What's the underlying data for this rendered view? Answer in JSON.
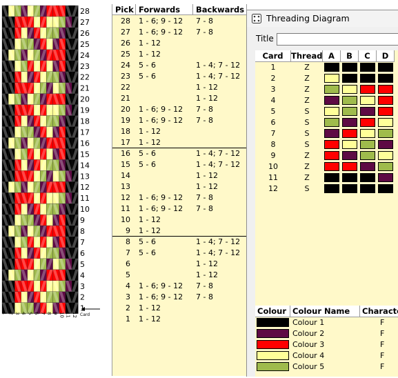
{
  "pick_table": {
    "headers": [
      "Pick",
      "Forwards",
      "Backwards"
    ],
    "rows": [
      {
        "pick": "28",
        "forwards": "1 - 6; 9 - 12",
        "backwards": "7 - 8"
      },
      {
        "pick": "27",
        "forwards": "1 - 6; 9 - 12",
        "backwards": "7 - 8"
      },
      {
        "pick": "26",
        "forwards": "1 - 12",
        "backwards": ""
      },
      {
        "pick": "25",
        "forwards": "1 - 12",
        "backwards": ""
      },
      {
        "pick": "24",
        "forwards": "5 - 6",
        "backwards": "1 - 4; 7 - 12"
      },
      {
        "pick": "23",
        "forwards": "5 - 6",
        "backwards": "1 - 4; 7 - 12"
      },
      {
        "pick": "22",
        "forwards": "",
        "backwards": "1 - 12"
      },
      {
        "pick": "21",
        "forwards": "",
        "backwards": "1 - 12"
      },
      {
        "pick": "20",
        "forwards": "1 - 6; 9 - 12",
        "backwards": "7 - 8"
      },
      {
        "pick": "19",
        "forwards": "1 - 6; 9 - 12",
        "backwards": "7 - 8"
      },
      {
        "pick": "18",
        "forwards": "1 - 12",
        "backwards": ""
      },
      {
        "pick": "17",
        "forwards": "1 - 12",
        "backwards": ""
      },
      {
        "pick": "16",
        "forwards": "5 - 6",
        "backwards": "1 - 4; 7 - 12"
      },
      {
        "pick": "15",
        "forwards": "5 - 6",
        "backwards": "1 - 4; 7 - 12"
      },
      {
        "pick": "14",
        "forwards": "",
        "backwards": "1 - 12"
      },
      {
        "pick": "13",
        "forwards": "",
        "backwards": "1 - 12"
      },
      {
        "pick": "12",
        "forwards": "1 - 6; 9 - 12",
        "backwards": "7 - 8"
      },
      {
        "pick": "11",
        "forwards": "1 - 6; 9 - 12",
        "backwards": "7 - 8"
      },
      {
        "pick": "10",
        "forwards": "1 - 12",
        "backwards": ""
      },
      {
        "pick": "9",
        "forwards": "1 - 12",
        "backwards": ""
      },
      {
        "pick": "8",
        "forwards": "5 - 6",
        "backwards": "1 - 4; 7 - 12"
      },
      {
        "pick": "7",
        "forwards": "5 - 6",
        "backwards": "1 - 4; 7 - 12"
      },
      {
        "pick": "6",
        "forwards": "",
        "backwards": "1 - 12"
      },
      {
        "pick": "5",
        "forwards": "",
        "backwards": "1 - 12"
      },
      {
        "pick": "4",
        "forwards": "1 - 6; 9 - 12",
        "backwards": "7 - 8"
      },
      {
        "pick": "3",
        "forwards": "1 - 6; 9 - 12",
        "backwards": "7 - 8"
      },
      {
        "pick": "2",
        "forwards": "1 - 12",
        "backwards": ""
      },
      {
        "pick": "1",
        "forwards": "1 - 12",
        "backwards": ""
      }
    ]
  },
  "weave": {
    "pick_labels": [
      "28",
      "27",
      "26",
      "25",
      "24",
      "23",
      "22",
      "21",
      "20",
      "19",
      "18",
      "17",
      "16",
      "15",
      "14",
      "13",
      "12",
      "11",
      "10",
      "9",
      "8",
      "7",
      "6",
      "5",
      "4",
      "3",
      "2",
      "1"
    ],
    "card_labels": [
      "1",
      "2",
      "3",
      "4",
      "5",
      "6",
      "7",
      "8",
      "9",
      "10",
      "11",
      "12"
    ],
    "card_axis_label": "Card"
  },
  "window": {
    "title": "Threading Diagram",
    "title_label": "Title",
    "title_value": "",
    "card_headers": [
      "Card",
      "Thread",
      "A",
      "B",
      "C",
      "D"
    ],
    "cards": [
      {
        "card": "1",
        "thread": "Z",
        "holes": [
          1,
          1,
          1,
          1
        ]
      },
      {
        "card": "2",
        "thread": "Z",
        "holes": [
          4,
          1,
          1,
          1
        ]
      },
      {
        "card": "3",
        "thread": "Z",
        "holes": [
          5,
          4,
          3,
          3
        ]
      },
      {
        "card": "4",
        "thread": "Z",
        "holes": [
          2,
          5,
          4,
          3
        ]
      },
      {
        "card": "5",
        "thread": "S",
        "holes": [
          4,
          5,
          2,
          3
        ]
      },
      {
        "card": "6",
        "thread": "S",
        "holes": [
          5,
          2,
          3,
          4
        ]
      },
      {
        "card": "7",
        "thread": "S",
        "holes": [
          2,
          3,
          4,
          5
        ]
      },
      {
        "card": "8",
        "thread": "S",
        "holes": [
          3,
          4,
          5,
          2
        ]
      },
      {
        "card": "9",
        "thread": "Z",
        "holes": [
          3,
          2,
          5,
          4
        ]
      },
      {
        "card": "10",
        "thread": "Z",
        "holes": [
          3,
          3,
          2,
          5
        ]
      },
      {
        "card": "11",
        "thread": "Z",
        "holes": [
          1,
          1,
          1,
          2
        ]
      },
      {
        "card": "12",
        "thread": "S",
        "holes": [
          1,
          1,
          1,
          1
        ]
      }
    ],
    "colour_headers": [
      "Colour",
      "Colour Name",
      "Characte"
    ],
    "colours": [
      {
        "name": "Colour 1",
        "char": "F",
        "hex": "#000000"
      },
      {
        "name": "Colour 2",
        "char": "F",
        "hex": "#5e0a44"
      },
      {
        "name": "Colour 3",
        "char": "F",
        "hex": "#ff0000"
      },
      {
        "name": "Colour 4",
        "char": "F",
        "hex": "#ffff99"
      },
      {
        "name": "Colour 5",
        "char": "F",
        "hex": "#9fbb4c"
      }
    ]
  }
}
